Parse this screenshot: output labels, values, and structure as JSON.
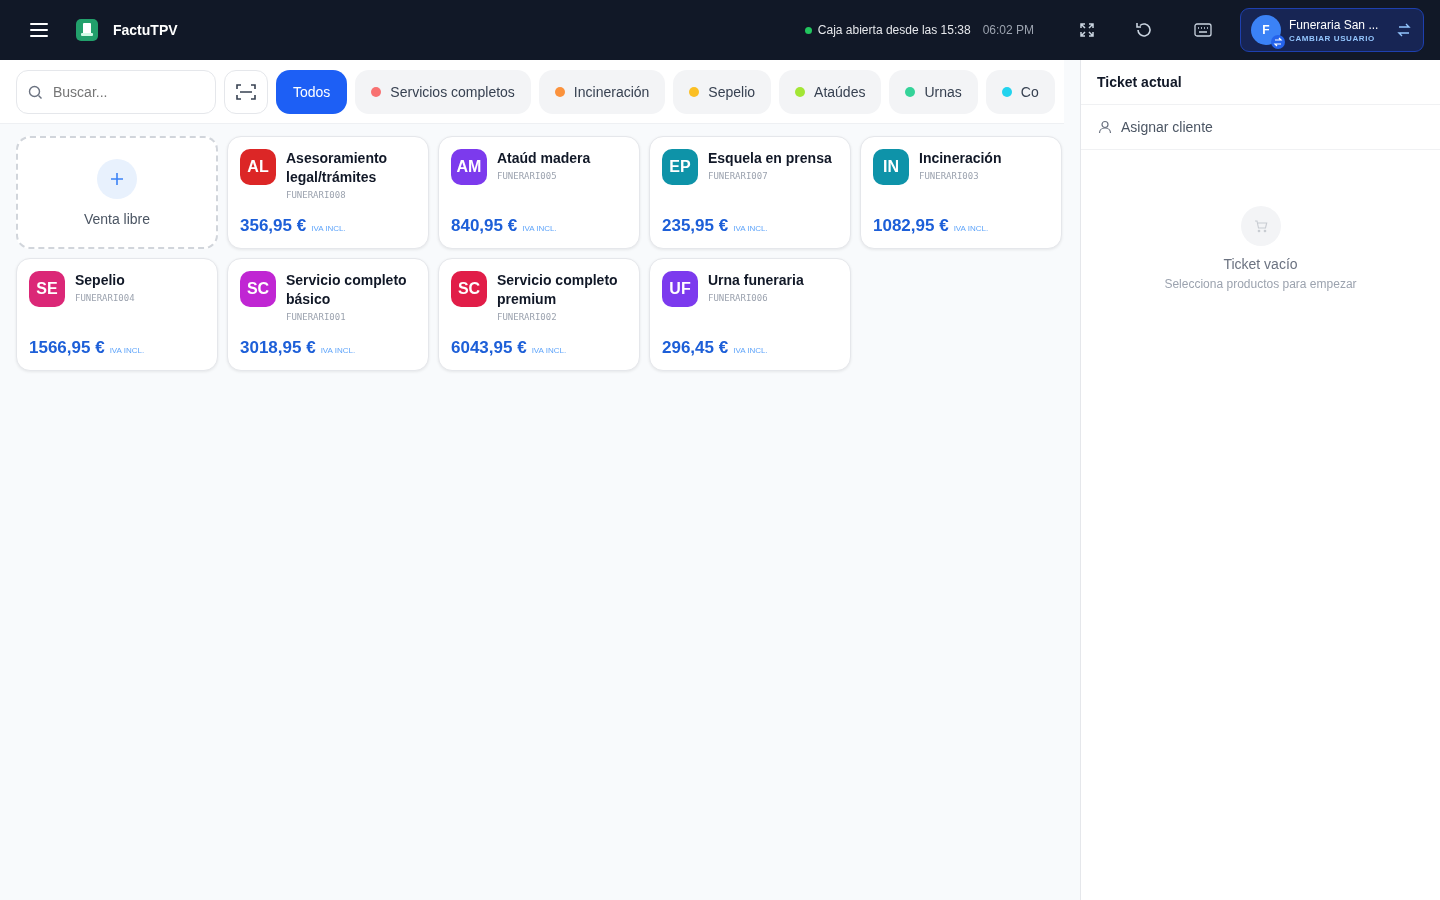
{
  "header": {
    "app_name": "FactuTPV",
    "status": "Caja abierta desde las 15:38",
    "time": "06:02 PM",
    "user": {
      "name": "Funeraria San ...",
      "initial": "F",
      "action": "CAMBIAR USUARIO"
    }
  },
  "search": {
    "placeholder": "Buscar..."
  },
  "categories": [
    {
      "label": "Todos",
      "selected": true
    },
    {
      "label": "Servicios completos",
      "selected": false,
      "color": "#f87171"
    },
    {
      "label": "Incineración",
      "selected": false,
      "color": "#fb923c"
    },
    {
      "label": "Sepelio",
      "selected": false,
      "color": "#fbbf24"
    },
    {
      "label": "Ataúdes",
      "selected": false,
      "color": "#a3e635"
    },
    {
      "label": "Urnas",
      "selected": false,
      "color": "#34d399"
    },
    {
      "label": "Co",
      "selected": false,
      "color": "#22d3ee"
    }
  ],
  "free_sale": {
    "label": "Venta libre"
  },
  "products": [
    {
      "initials": "AL",
      "name": "Asesoramiento legal/trámites",
      "code": "FUNERARI008",
      "price": "356,95 €",
      "tax": "IVA INCL.",
      "color": "#dc2626"
    },
    {
      "initials": "AM",
      "name": "Ataúd madera",
      "code": "FUNERARI005",
      "price": "840,95 €",
      "tax": "IVA INCL.",
      "color": "#7c3aed"
    },
    {
      "initials": "EP",
      "name": "Esquela en prensa",
      "code": "FUNERARI007",
      "price": "235,95 €",
      "tax": "IVA INCL.",
      "color": "#0e93a8"
    },
    {
      "initials": "IN",
      "name": "Incineración",
      "code": "FUNERARI003",
      "price": "1082,95 €",
      "tax": "IVA INCL.",
      "color": "#0e93a9"
    },
    {
      "initials": "SE",
      "name": "Sepelio",
      "code": "FUNERARI004",
      "price": "1566,95 €",
      "tax": "IVA INCL.",
      "color": "#db2777"
    },
    {
      "initials": "SC",
      "name": "Servicio completo básico",
      "code": "FUNERARI001",
      "price": "3018,95 €",
      "tax": "IVA INCL.",
      "color": "#c026d3"
    },
    {
      "initials": "SC",
      "name": "Servicio completo premium",
      "code": "FUNERARI002",
      "price": "6043,95 €",
      "tax": "IVA INCL.",
      "color": "#e11d48"
    },
    {
      "initials": "UF",
      "name": "Urna funeraria",
      "code": "FUNERARI006",
      "price": "296,45 €",
      "tax": "IVA INCL.",
      "color": "#7c3aee"
    }
  ],
  "ticket": {
    "title": "Ticket actual",
    "assign_client": "Asignar cliente",
    "empty_title": "Ticket vacío",
    "empty_hint": "Selecciona productos para empezar"
  }
}
